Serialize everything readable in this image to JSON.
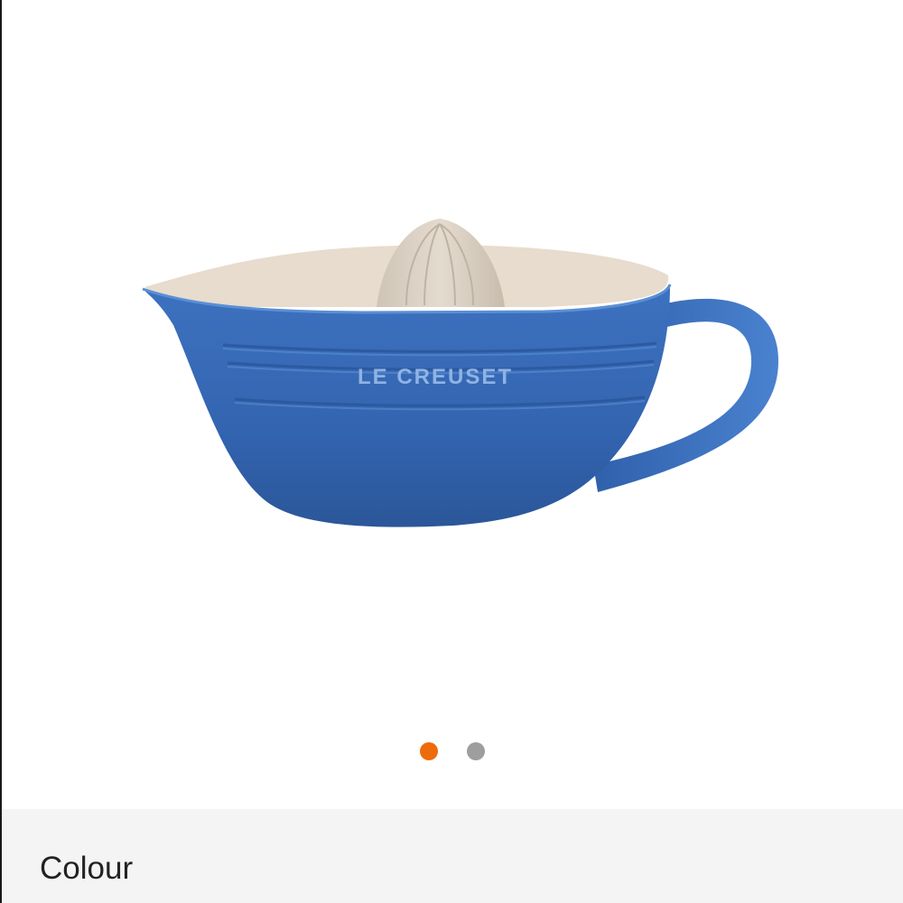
{
  "gallery": {
    "product": {
      "brand_mark": "LE CREUSET",
      "colors": {
        "body": "#3567b3",
        "body_dark": "#2c5496",
        "inner": "#e8ddd0",
        "reamer": "#d9cfc2"
      }
    },
    "pager": {
      "active_index": 0,
      "count": 2,
      "active_color": "#ee6b0c",
      "inactive_color": "#9e9e9e"
    }
  },
  "options": {
    "colour_label": "Colour"
  }
}
